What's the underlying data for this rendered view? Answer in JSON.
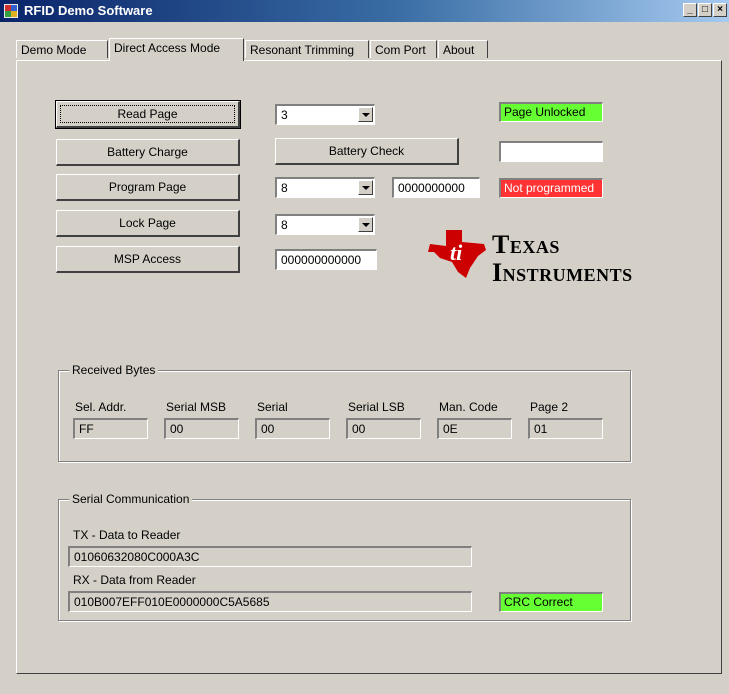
{
  "window": {
    "title": "RFID Demo Software",
    "minimize_glyph": "_",
    "maximize_glyph": "□",
    "close_glyph": "×"
  },
  "tabs": [
    {
      "label": "Demo Mode",
      "active": false
    },
    {
      "label": "Direct Access Mode",
      "active": true
    },
    {
      "label": "Resonant Trimming",
      "active": false
    },
    {
      "label": "Com Port",
      "active": false
    },
    {
      "label": "About",
      "active": false
    }
  ],
  "buttons": {
    "read_page": "Read Page",
    "battery_charge": "Battery Charge",
    "battery_check": "Battery Check",
    "program_page": "Program Page",
    "lock_page": "Lock Page",
    "msp_access": "MSP Access"
  },
  "inputs": {
    "read_page_select": "3",
    "program_page_select": "8",
    "program_data": "0000000000",
    "lock_page_select": "8",
    "msp_data": "000000000000",
    "battery_check_result": ""
  },
  "status": {
    "page_lock": {
      "text": "Page Unlocked",
      "color": "#66ff33"
    },
    "program": {
      "text": "Not programmed",
      "color": "#ff3333"
    },
    "crc": {
      "text": "CRC Correct",
      "color": "#66ff33"
    }
  },
  "logo": {
    "line1": "Texas",
    "line2": "Instruments",
    "color": "#cc0000"
  },
  "received_bytes": {
    "title": "Received Bytes",
    "fields": [
      {
        "label": "Sel. Addr.",
        "value": "FF"
      },
      {
        "label": "Serial MSB",
        "value": "00"
      },
      {
        "label": "Serial",
        "value": "00"
      },
      {
        "label": "Serial LSB",
        "value": "00"
      },
      {
        "label": "Man. Code",
        "value": "0E"
      },
      {
        "label": "Page 2",
        "value": "01"
      }
    ]
  },
  "serial_comm": {
    "title": "Serial Communication",
    "tx_label": "TX - Data to Reader",
    "tx_value": "01060632080C000A3C",
    "rx_label": "RX - Data from Reader",
    "rx_value": "010B007EFF010E0000000C5A5685"
  }
}
